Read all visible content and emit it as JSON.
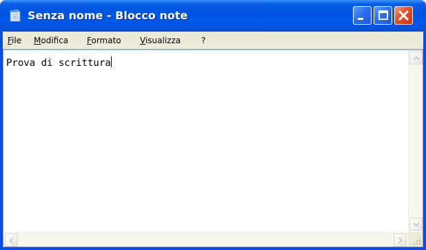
{
  "window": {
    "title": "Senza nome - Blocco note",
    "app_icon": "notepad-icon",
    "controls": {
      "minimize": "minimize-icon",
      "maximize": "maximize-icon",
      "close": "close-icon"
    }
  },
  "menu": {
    "items": [
      {
        "label": "File"
      },
      {
        "label": "Modifica"
      },
      {
        "label": "Formato"
      },
      {
        "label": "Visualizza"
      },
      {
        "label": "?"
      }
    ]
  },
  "editor": {
    "text": "Prova di scrittura"
  },
  "colors": {
    "titlebar": "#0054e3",
    "menubar": "#ece9d8",
    "close_button": "#e2502a"
  }
}
